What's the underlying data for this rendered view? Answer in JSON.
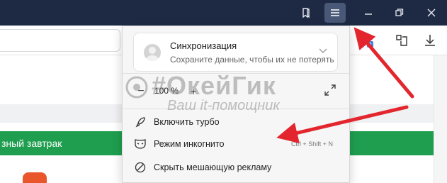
{
  "titlebar": {
    "background": "#1e2a44",
    "buttons": [
      {
        "name": "bookmarks-panel-icon"
      },
      {
        "name": "menu-icon"
      },
      {
        "name": "minimize-icon"
      },
      {
        "name": "restore-icon"
      },
      {
        "name": "close-icon"
      }
    ]
  },
  "toolbar": {
    "extensions": [
      {
        "name": "extension-icon"
      },
      {
        "name": "extension-icon-2"
      },
      {
        "name": "download-icon"
      }
    ]
  },
  "page": {
    "promo_text": "зный завтрак",
    "promo_color": "#1f9e4f"
  },
  "menu": {
    "sync": {
      "title": "Синхронизация",
      "subtitle": "Сохраните данные, чтобы их не потерять"
    },
    "zoom": {
      "minus": "−",
      "value": "100 %",
      "plus": "+"
    },
    "items": [
      {
        "label": "Включить турбо",
        "icon": "rocket-icon",
        "shortcut": ""
      },
      {
        "label": "Режим инкогнито",
        "icon": "incognito-mask-icon",
        "shortcut": "Ctrl + Shift + N"
      },
      {
        "label": "Скрыть мешающую рекламу",
        "icon": "block-ads-icon",
        "shortcut": ""
      }
    ]
  },
  "watermark": {
    "title": "#ОкейГик",
    "subtitle": "Ваш it-помощник"
  },
  "annotation_color": "#e3262e"
}
